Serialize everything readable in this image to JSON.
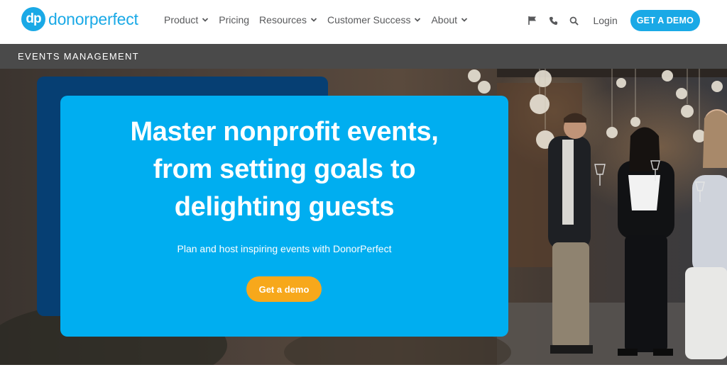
{
  "brand": {
    "logo_mark": "dp",
    "logo_text": "donorperfect",
    "color": "#1aa9e6"
  },
  "nav": {
    "items": [
      {
        "label": "Product",
        "has_dropdown": true
      },
      {
        "label": "Pricing",
        "has_dropdown": false
      },
      {
        "label": "Resources",
        "has_dropdown": true
      },
      {
        "label": "Customer Success",
        "has_dropdown": true
      },
      {
        "label": "About",
        "has_dropdown": true
      }
    ],
    "icons": [
      "flag-icon",
      "phone-icon",
      "search-icon"
    ],
    "login_label": "Login",
    "demo_label": "GET A DEMO"
  },
  "section": {
    "title": "EVENTS MANAGEMENT"
  },
  "hero": {
    "headline_lines": [
      "Master nonprofit events,",
      "from setting goals to",
      "delighting guests"
    ],
    "subline": "Plan and host inspiring events with DonorPerfect",
    "cta_label": "Get a demo",
    "colors": {
      "card": "#00aef0",
      "card_back": "#063f73",
      "cta": "#f7a81b"
    }
  }
}
